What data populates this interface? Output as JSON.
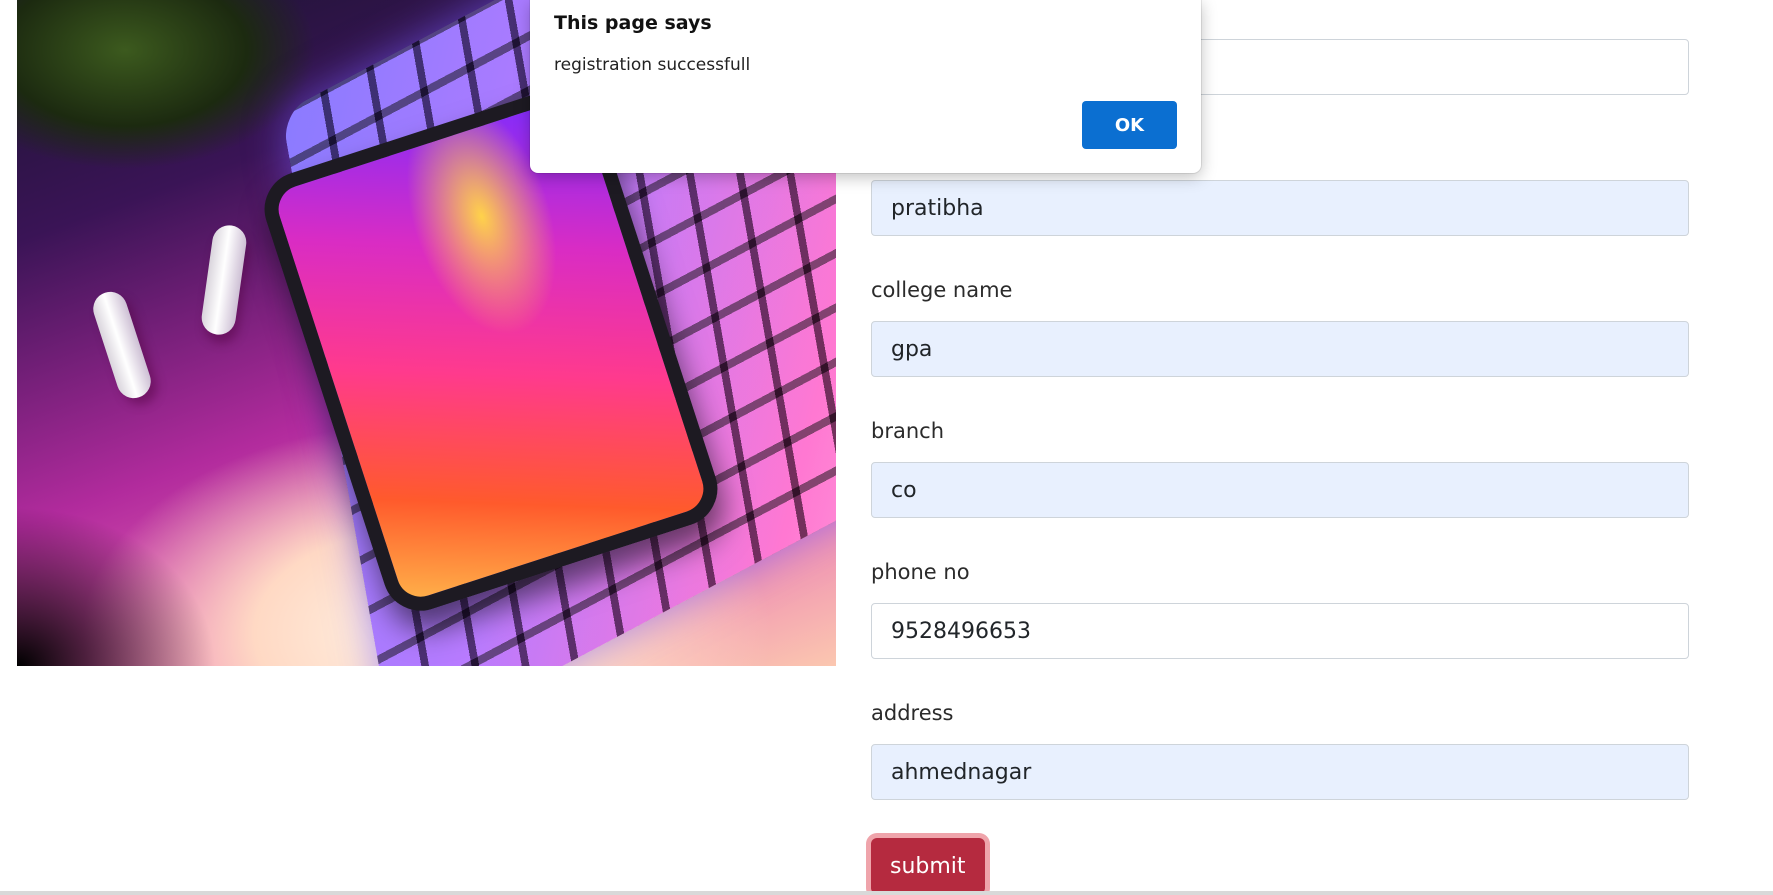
{
  "hero_image": {
    "description_icon": "laptop-phone-earbuds-photo"
  },
  "form": {
    "fields": [
      {
        "label": "",
        "value": "",
        "autofilled": false
      },
      {
        "label": "",
        "value": "pratibha",
        "autofilled": true
      },
      {
        "label": "college name",
        "value": "gpa",
        "autofilled": true
      },
      {
        "label": "branch",
        "value": "co",
        "autofilled": true
      },
      {
        "label": "phone no",
        "value": "9528496653",
        "autofilled": false
      },
      {
        "label": "address",
        "value": "ahmednagar",
        "autofilled": true
      }
    ],
    "submit_label": "submit"
  },
  "dialog": {
    "title": "This page says",
    "message": "registration successfull",
    "ok_label": "OK"
  },
  "colors": {
    "autofill_bg": "#e8f0fe",
    "submit_bg": "#b52a3f",
    "ok_button_bg": "#0b6fd1"
  }
}
